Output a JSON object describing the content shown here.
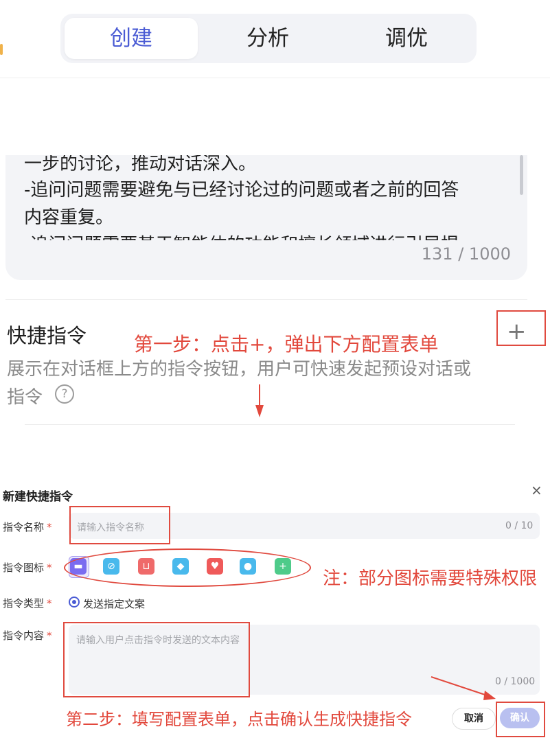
{
  "tabs": [
    {
      "label": "创建",
      "active": true
    },
    {
      "label": "分析",
      "active": false
    },
    {
      "label": "调优",
      "active": false
    }
  ],
  "prompt": {
    "lines": [
      "一步的讨论，推动对话深入。",
      "-追问问题需要避免与已经讨论过的问题或者之前的回答",
      "内容重复。",
      "-追问问题需要基于智能体的功能和擅长领域进行引导提"
    ],
    "counter": "131 / 1000"
  },
  "shortcut_section": {
    "title": "快捷指令",
    "description_line1": "展示在对话框上方的指令按钮，用户可快速发起预设对话或",
    "description_line2": "指令",
    "help_icon": "question-circle-icon",
    "add_icon": "plus-icon",
    "add_symbol": "+"
  },
  "annotations": {
    "step1": "第一步：点击+，弹出下方配置表单",
    "note": "注：部分图标需要特殊权限",
    "step2": "第二步：填写配置表单，点击确认生成快捷指令"
  },
  "dialog": {
    "title": "新建快捷指令",
    "close_icon": "close-icon",
    "close_symbol": "×",
    "required_mark": "*",
    "name_label": "指令名称",
    "name_placeholder": "请输入指令名称",
    "name_counter": "0 / 10",
    "icon_label": "指令图标",
    "icon_options": [
      {
        "name": "chat-icon",
        "color": "#7b6cf0",
        "glyph": "▬",
        "selected": true
      },
      {
        "name": "link-icon",
        "color": "#49b9ec",
        "glyph": "⊘",
        "selected": false
      },
      {
        "name": "mail-icon",
        "color": "#ef6a6a",
        "glyph": "⊔",
        "selected": false
      },
      {
        "name": "pencil-icon",
        "color": "#49b9ec",
        "glyph": "◆",
        "selected": false
      },
      {
        "name": "heart-icon",
        "color": "#ef5a5a",
        "glyph": "♥",
        "selected": false
      },
      {
        "name": "bottle-icon",
        "color": "#49b9ec",
        "glyph": "●",
        "selected": false
      },
      {
        "name": "calendar-plus-icon",
        "color": "#4ecb8a",
        "glyph": "+",
        "selected": false
      }
    ],
    "type_label": "指令类型",
    "type_option": "发送指定文案",
    "content_label": "指令内容",
    "content_placeholder": "请输入用户点击指令时发送的文本内容",
    "content_counter": "0 / 1000",
    "cancel_label": "取消",
    "confirm_label": "确认",
    "accent_color": "#4a5bd4",
    "annotation_color": "#e2483c"
  }
}
